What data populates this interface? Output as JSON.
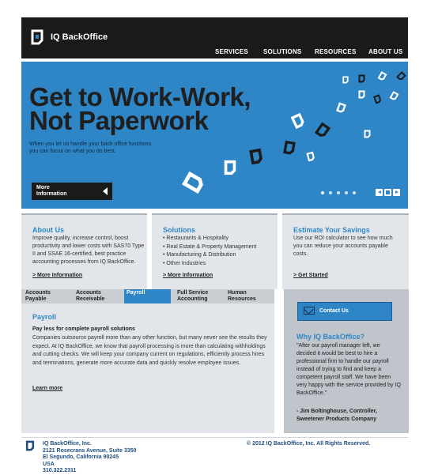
{
  "header": {
    "logo_text": "IQ BackOffice",
    "nav": [
      "SERVICES",
      "SOLUTIONS",
      "RESOURCES",
      "ABOUT US"
    ]
  },
  "hero": {
    "title_line1": "Get to Work-Work,",
    "title_line2": "Not Paperwork",
    "subtitle_line1": "When you let us handle your back office functions,",
    "subtitle_line2": "you can focus on what you do best.",
    "more_button_line1": "More",
    "more_button_line2": "Information",
    "slide_count": 5,
    "active_slide": 1
  },
  "boxes": {
    "about": {
      "title": "About Us",
      "body": "Improve quality, increase control, boost productivity and lower costs with SAS70 Type II and SSAE 16-certified, best practice accounting processes from IQ BackOffice.",
      "link": "> More Information"
    },
    "solutions": {
      "title": "Solutions",
      "items": [
        "Restaurants & Hospitality",
        "Real Estate & Property Management",
        "Manufacturing & Distribution",
        "Other Industries"
      ],
      "link": "> More Information"
    },
    "estimate": {
      "title": "Estimate Your Savings",
      "body": "Use our ROI calculator to see how much you can reduce your accounts payable costs.",
      "link": "> Get Started"
    }
  },
  "tabs": [
    {
      "line1": "Accounts",
      "line2": "Payable"
    },
    {
      "line1": "Accounts",
      "line2": "Receivable"
    },
    {
      "line1": "Payroll",
      "line2": ""
    },
    {
      "line1": "Full Service",
      "line2": "Accounting"
    },
    {
      "line1": "Human",
      "line2": "Resources"
    }
  ],
  "panel": {
    "title": "Payroll",
    "heading": "Pay less for complete payroll solutions",
    "body": "Companies outsource payroll more than any other function, but many never see the results they expect. At IQ BackOffice, we know that payroll processing is more than calculating withholdings and cutting checks. We will keep your company current on regulations, efficiently process hires and terminations, generate more accurate data and quickly resolve employee issues.",
    "link": "Learn more"
  },
  "sidebar": {
    "contact_label": "Contact Us",
    "title": "Why IQ BackOffice?",
    "quote": "\"After our payroll manager left, we decided it would be best to hire a professional firm to handle our payroll instead of trying to find and keep a competent payroll staff. We have been very happy with the service provided by IQ BackOffice.\"",
    "author_line1": "- Jim Boltinghouse, Controller,",
    "author_line2": "Sweetener Products Company"
  },
  "footer": {
    "address": [
      "IQ BackOffice, Inc.",
      "2121 Rosecrans Avenue, Suite 3350",
      "El Segundo, California 90245",
      "USA",
      "310.322.2311"
    ],
    "copyright": "© 2012 IQ BackOffice, Inc. All Rights Reserved."
  },
  "colors": {
    "brand_blue": "#2f86c6",
    "header_dark": "#1a1a1a",
    "panel_gray": "#e2e6ea"
  }
}
